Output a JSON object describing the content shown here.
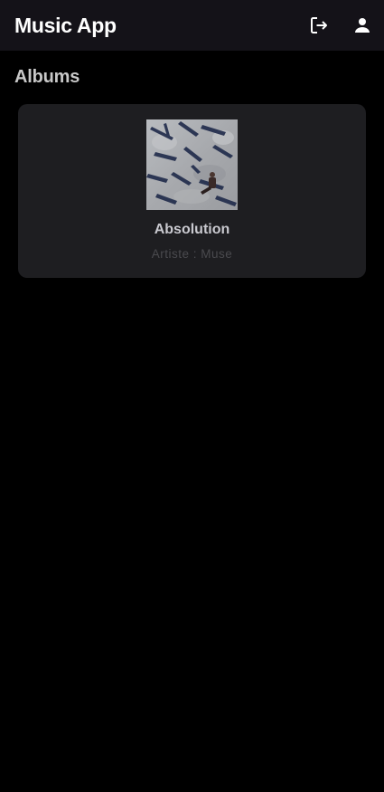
{
  "app_bar": {
    "title": "Music App",
    "actions": [
      {
        "icon": "logout-icon"
      },
      {
        "icon": "account-icon"
      }
    ]
  },
  "main": {
    "section_title": "Albums",
    "albums": [
      {
        "title": "Absolution",
        "artist_line": "Artiste : Muse",
        "cover_icon": "album-cover-image"
      }
    ]
  },
  "colors": {
    "background": "#000000",
    "app_bar": "#141218",
    "card": "#1e1e21",
    "title_text": "#ffffff"
  }
}
